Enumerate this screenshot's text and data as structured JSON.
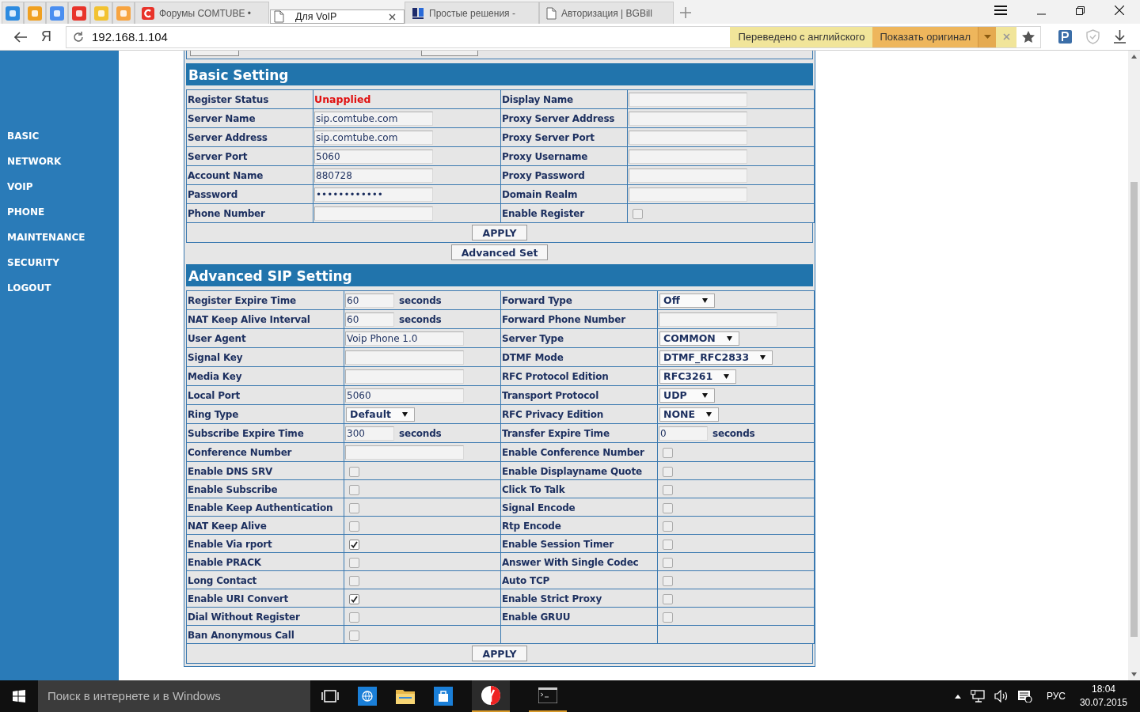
{
  "browser": {
    "tabs": [
      {
        "title": "Форумы COMTUBE •",
        "selected": false
      },
      {
        "title": "Для VoIP",
        "selected": true
      },
      {
        "title": "Простые решения -",
        "selected": false
      },
      {
        "title": "Авторизация | BGBill",
        "selected": false
      }
    ],
    "home_glyph": "Я",
    "address": "192.168.1.104",
    "translate_bar": {
      "status": "Переведено с английского",
      "show_original": "Показать оригинал"
    }
  },
  "sidebar": {
    "items": [
      "BASIC",
      "NETWORK",
      "VOIP",
      "PHONE",
      "MAINTENANCE",
      "SECURITY",
      "LOGOUT"
    ]
  },
  "basic_setting": {
    "title": "Basic Setting",
    "rows": [
      [
        {
          "kind": "label",
          "text": "Register Status"
        },
        {
          "kind": "status",
          "text": "Unapplied"
        },
        {
          "kind": "label",
          "text": "Display Name"
        },
        {
          "kind": "input"
        }
      ],
      [
        {
          "kind": "label",
          "text": "Server Name"
        },
        {
          "kind": "input",
          "value": "sip.comtube.com"
        },
        {
          "kind": "label",
          "text": "Proxy Server Address"
        },
        {
          "kind": "input"
        }
      ],
      [
        {
          "kind": "label",
          "text": "Server Address"
        },
        {
          "kind": "input",
          "value": "sip.comtube.com"
        },
        {
          "kind": "label",
          "text": "Proxy Server Port"
        },
        {
          "kind": "input"
        }
      ],
      [
        {
          "kind": "label",
          "text": "Server Port"
        },
        {
          "kind": "input",
          "value": "5060"
        },
        {
          "kind": "label",
          "text": "Proxy Username"
        },
        {
          "kind": "input"
        }
      ],
      [
        {
          "kind": "label",
          "text": "Account Name"
        },
        {
          "kind": "input",
          "value": "880728"
        },
        {
          "kind": "label",
          "text": "Proxy Password"
        },
        {
          "kind": "input"
        }
      ],
      [
        {
          "kind": "label",
          "text": "Password"
        },
        {
          "kind": "input",
          "value": "••••••••••••"
        },
        {
          "kind": "label",
          "text": "Domain Realm"
        },
        {
          "kind": "input"
        }
      ],
      [
        {
          "kind": "label",
          "text": "Phone Number"
        },
        {
          "kind": "input"
        },
        {
          "kind": "label",
          "text": "Enable Register"
        },
        {
          "kind": "checkbox",
          "checked": false
        }
      ]
    ],
    "apply": "APPLY"
  },
  "advanced_button": "Advanced Set",
  "advanced_sip_setting": {
    "title": "Advanced SIP Setting",
    "rows": [
      [
        {
          "kind": "label",
          "text": "Register Expire Time"
        },
        {
          "kind": "input",
          "value": "60",
          "unit": "seconds"
        },
        {
          "kind": "label",
          "text": "Forward Type"
        },
        {
          "kind": "select",
          "value": "Off"
        }
      ],
      [
        {
          "kind": "label",
          "text": "NAT Keep Alive Interval"
        },
        {
          "kind": "input",
          "value": "60",
          "unit": "seconds"
        },
        {
          "kind": "label",
          "text": "Forward Phone Number"
        },
        {
          "kind": "input"
        }
      ],
      [
        {
          "kind": "label",
          "text": "User Agent"
        },
        {
          "kind": "input",
          "value": "Voip Phone 1.0"
        },
        {
          "kind": "label",
          "text": "Server Type"
        },
        {
          "kind": "select",
          "value": "COMMON"
        }
      ],
      [
        {
          "kind": "label",
          "text": "Signal Key"
        },
        {
          "kind": "input"
        },
        {
          "kind": "label",
          "text": "DTMF Mode"
        },
        {
          "kind": "select",
          "value": "DTMF_RFC2833"
        }
      ],
      [
        {
          "kind": "label",
          "text": "Media Key"
        },
        {
          "kind": "input"
        },
        {
          "kind": "label",
          "text": "RFC Protocol Edition"
        },
        {
          "kind": "select",
          "value": "RFC3261"
        }
      ],
      [
        {
          "kind": "label",
          "text": "Local Port"
        },
        {
          "kind": "input",
          "value": "5060"
        },
        {
          "kind": "label",
          "text": "Transport Protocol"
        },
        {
          "kind": "select",
          "value": "UDP"
        }
      ],
      [
        {
          "kind": "label",
          "text": "Ring Type"
        },
        {
          "kind": "select",
          "value": "Default"
        },
        {
          "kind": "label",
          "text": "RFC Privacy Edition"
        },
        {
          "kind": "select",
          "value": "NONE"
        }
      ],
      [
        {
          "kind": "label",
          "text": "Subscribe Expire Time"
        },
        {
          "kind": "input",
          "value": "300",
          "unit": "seconds"
        },
        {
          "kind": "label",
          "text": "Transfer Expire Time"
        },
        {
          "kind": "input",
          "value": "0",
          "unit": "seconds"
        }
      ],
      [
        {
          "kind": "label",
          "text": "Conference Number"
        },
        {
          "kind": "input"
        },
        {
          "kind": "label",
          "text": "Enable Conference Number"
        },
        {
          "kind": "checkbox",
          "checked": false
        }
      ],
      [
        {
          "kind": "label",
          "text": "Enable DNS SRV"
        },
        {
          "kind": "checkbox",
          "checked": false
        },
        {
          "kind": "label",
          "text": "Enable Displayname Quote"
        },
        {
          "kind": "checkbox",
          "checked": false
        }
      ],
      [
        {
          "kind": "label",
          "text": "Enable Subscribe"
        },
        {
          "kind": "checkbox",
          "checked": false
        },
        {
          "kind": "label",
          "text": "Click To Talk"
        },
        {
          "kind": "checkbox",
          "checked": false
        }
      ],
      [
        {
          "kind": "label",
          "text": "Enable Keep Authentication"
        },
        {
          "kind": "checkbox",
          "checked": false
        },
        {
          "kind": "label",
          "text": "Signal Encode"
        },
        {
          "kind": "checkbox",
          "checked": false
        }
      ],
      [
        {
          "kind": "label",
          "text": "NAT Keep Alive"
        },
        {
          "kind": "checkbox",
          "checked": false
        },
        {
          "kind": "label",
          "text": "Rtp Encode"
        },
        {
          "kind": "checkbox",
          "checked": false
        }
      ],
      [
        {
          "kind": "label",
          "text": "Enable Via rport"
        },
        {
          "kind": "checkbox",
          "checked": true
        },
        {
          "kind": "label",
          "text": "Enable Session Timer"
        },
        {
          "kind": "checkbox",
          "checked": false
        }
      ],
      [
        {
          "kind": "label",
          "text": "Enable PRACK"
        },
        {
          "kind": "checkbox",
          "checked": false
        },
        {
          "kind": "label",
          "text": "Answer With Single Codec"
        },
        {
          "kind": "checkbox",
          "checked": false
        }
      ],
      [
        {
          "kind": "label",
          "text": "Long Contact"
        },
        {
          "kind": "checkbox",
          "checked": false
        },
        {
          "kind": "label",
          "text": "Auto TCP"
        },
        {
          "kind": "checkbox",
          "checked": false
        }
      ],
      [
        {
          "kind": "label",
          "text": "Enable URI Convert"
        },
        {
          "kind": "checkbox",
          "checked": true
        },
        {
          "kind": "label",
          "text": "Enable Strict Proxy"
        },
        {
          "kind": "checkbox",
          "checked": false
        }
      ],
      [
        {
          "kind": "label",
          "text": "Dial Without Register"
        },
        {
          "kind": "checkbox",
          "checked": false
        },
        {
          "kind": "label",
          "text": "Enable GRUU"
        },
        {
          "kind": "checkbox",
          "checked": false
        }
      ],
      [
        {
          "kind": "label",
          "text": "Ban Anonymous Call"
        },
        {
          "kind": "checkbox",
          "checked": false
        },
        {
          "kind": "empty"
        },
        {
          "kind": "empty"
        }
      ]
    ],
    "apply": "APPLY"
  },
  "taskbar": {
    "search_placeholder": "Поиск в интернете и в Windows",
    "language": "РУС",
    "time": "18:04",
    "date": "30.07.2015"
  }
}
